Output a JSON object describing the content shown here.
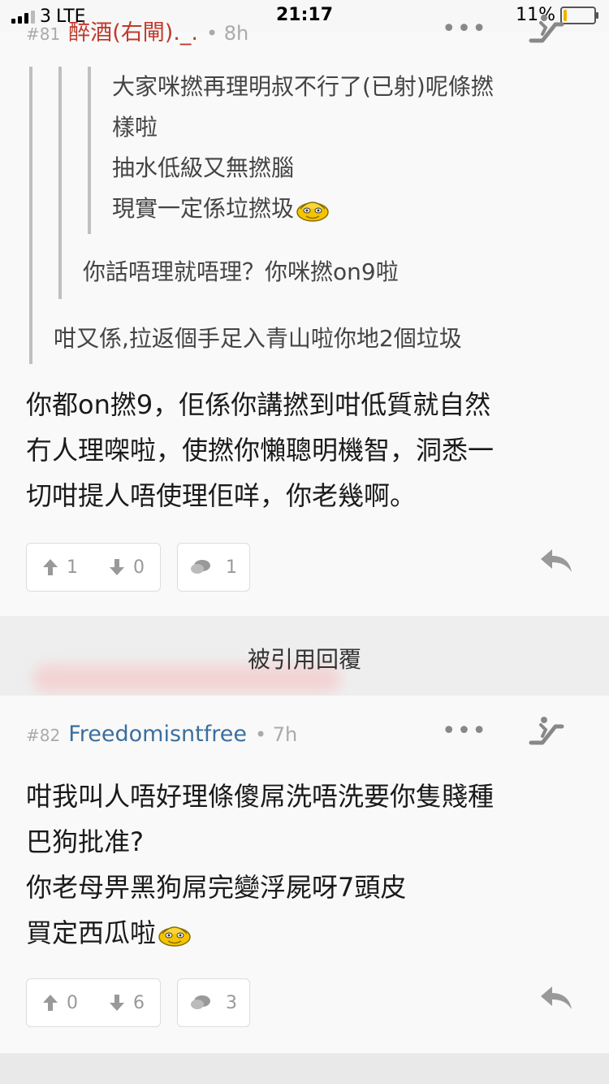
{
  "status_bar": {
    "carrier": "3",
    "network": "LTE",
    "time": "21:17",
    "battery": "11%"
  },
  "post81": {
    "number": "#81",
    "author": "醉酒(右閘)._.",
    "age": "8h",
    "quote_level3_lines": [
      "大家咪撚再理明叔不行了(已射)呢條撚",
      "樣啦",
      "抽水低級又無撚腦",
      "現實一定係垃撚圾"
    ],
    "quote_level2_line": "你話唔理就唔理？你咪撚on9啦",
    "quote_level1_line": "咁又係,拉返個手足入青山啦你地2個垃圾",
    "body_lines": [
      "你都on撚9，佢係你講撚到咁低質就自然",
      "冇人理㗎啦，使撚你懶聰明機智，洞悉一",
      "切咁提人唔使理佢咩，你老幾啊。"
    ],
    "upvotes": "1",
    "downvotes": "0",
    "replies": "1"
  },
  "quoted_divider": {
    "label": "被引用回覆"
  },
  "post82": {
    "number": "#82",
    "author": "Freedomisntfree",
    "age": "7h",
    "body_lines": [
      "咁我叫人唔好理條傻屌洗唔洗要你隻賤種",
      "巴狗批准?",
      "你老母畀黑狗屌完變浮屍呀7頭皮",
      "買定西瓜啦"
    ],
    "upvotes": "0",
    "downvotes": "6",
    "replies": "3"
  },
  "colors": {
    "author81": "#c0392b",
    "author82": "#3b6e9e",
    "divider_bg": "#eeeeee"
  },
  "icons": [
    "up-arrow-icon",
    "down-arrow-icon",
    "comment-icon",
    "reply-icon",
    "more-icon",
    "emoji-icon"
  ]
}
